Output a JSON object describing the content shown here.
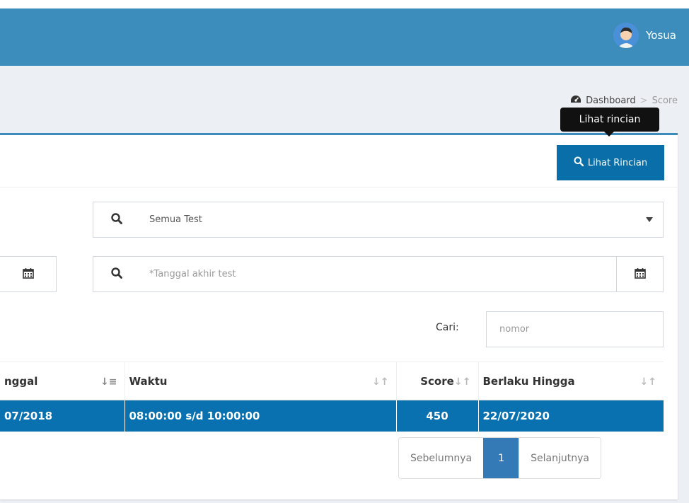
{
  "header": {
    "user_name": "Yosua"
  },
  "breadcrumb": {
    "home": "Dashboard",
    "separator": ">",
    "current": "Score"
  },
  "tooltip": {
    "text": "Lihat rincian"
  },
  "toolbar": {
    "detail_button": "Lihat Rincian"
  },
  "filters": {
    "test_select": "Semua Test",
    "end_date_placeholder": "*Tanggal akhir test"
  },
  "search": {
    "label": "Cari:",
    "placeholder": "nomor"
  },
  "table": {
    "headers": [
      "nggal",
      "Waktu",
      "Score",
      "Berlaku Hingga"
    ],
    "rows": [
      [
        "07/2018",
        "08:00:00 s/d 10:00:00",
        "450",
        "22/07/2020"
      ]
    ]
  },
  "pagination": {
    "prev": "Sebelumnya",
    "current": "1",
    "next": "Selanjutnya"
  },
  "colors": {
    "navbar": "#3c8dbc",
    "primary": "#0a6fa8",
    "selected_row": "#0a71b0",
    "page_active": "#337ab7"
  }
}
